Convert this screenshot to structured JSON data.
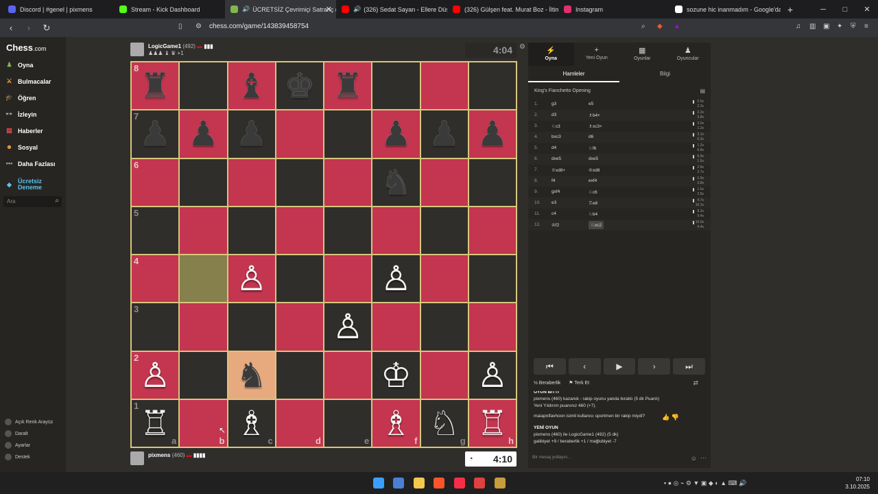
{
  "browser": {
    "tabs": [
      {
        "label": "Discord | #genel | pixmens",
        "color": "#5865f2",
        "sound": false
      },
      {
        "label": "Stream - Kick Dashboard",
        "color": "#53fc18",
        "sound": false
      },
      {
        "label": "ÜCRETSİZ Çevrimiçi Satranç (",
        "color": "#81b64c",
        "sound": true
      },
      {
        "label": "(326) Sedat Sayan - Ellere Düş - Y",
        "color": "#ff0000",
        "sound": true
      },
      {
        "label": "(326) Gülşen feat. Murat Boz - İltima",
        "color": "#ff0000",
        "sound": false
      },
      {
        "label": "Instagram",
        "color": "#e1306c",
        "sound": false
      },
      {
        "label": "sozune hic inanmadım - Google'da A",
        "color": "#ffffff",
        "sound": false
      }
    ],
    "url": "chess.com/game/143839458754",
    "new_tab": "+",
    "min": "─",
    "max": "□",
    "close": "✕"
  },
  "sidebar": {
    "logo": "Chess",
    "logo_suffix": ".com",
    "items": [
      {
        "label": "Oyna",
        "color": "#81b64c"
      },
      {
        "label": "Bulmacalar",
        "color": "#f7a13a"
      },
      {
        "label": "Öğren",
        "color": "#e84a4a"
      },
      {
        "label": "İzleyin",
        "color": "#ffffff"
      },
      {
        "label": "Haberler",
        "color": "#e84a4a"
      },
      {
        "label": "Sosyal",
        "color": "#f7a13a"
      },
      {
        "label": "Daha Fazlası",
        "color": "#aaaaaa"
      }
    ],
    "trial": "Ücretsiz Deneme",
    "search_placeholder": "Ara",
    "bottom": [
      "Açık Renk Arayüz",
      "Daralt",
      "Ayarlar",
      "Destek"
    ]
  },
  "top_player": {
    "name": "LogicGame1",
    "rating": "(492)",
    "captured": "♟♟♟ ♝ ♛ +1",
    "clock": "4:04"
  },
  "bottom_player": {
    "name": "pixmens",
    "rating": "(460)",
    "captured": "",
    "clock": "4:10"
  },
  "board": {
    "ranks": [
      "8",
      "7",
      "6",
      "5",
      "4",
      "3",
      "2",
      "1"
    ],
    "files": [
      "a",
      "b",
      "c",
      "d",
      "e",
      "f",
      "g",
      "h"
    ],
    "pieces": {
      "a8": "♜b",
      "c8": "♝b",
      "d8": "♚b",
      "e8": "♜b",
      "a7": "♟b",
      "b7": "♟b",
      "c7": "♟b",
      "f7": "♟b",
      "g7": "♟b",
      "h7": "♟b",
      "f6": "♞b",
      "c4": "♙w",
      "f4": "♙w",
      "e3": "♙w",
      "a2": "♙w",
      "c2": "♞b",
      "f2": "♔w",
      "h2": "♙w",
      "a1": "♖w",
      "c1": "♗w",
      "f1": "♗w",
      "g1": "♘w",
      "h1": "♖w"
    },
    "highlight_from": "b4",
    "highlight_to": "c2"
  },
  "panel": {
    "tabs": [
      {
        "label": "Oyna",
        "icon": "⚡"
      },
      {
        "label": "Yeni Oyun",
        "icon": "+"
      },
      {
        "label": "Oyunlar",
        "icon": "▦"
      },
      {
        "label": "Oyuncular",
        "icon": "♟"
      }
    ],
    "subtabs": [
      "Hamleler",
      "Bilgi"
    ],
    "opening": "King's Fianchetto Opening",
    "moves": [
      {
        "n": "1.",
        "w": "g3",
        "b": "e5",
        "t1": "0.5s",
        "t2": "2.2s"
      },
      {
        "n": "2.",
        "w": "d3",
        "b": "♗b4+",
        "t1": "2.2s",
        "t2": "3.8s"
      },
      {
        "n": "3.",
        "w": "♘c3",
        "b": "♗xc3+",
        "t1": "3.0s",
        "t2": "1.2s"
      },
      {
        "n": "4.",
        "w": "bxc3",
        "b": "d6",
        "t1": "3.1s",
        "t2": "6.3s"
      },
      {
        "n": "5.",
        "w": "d4",
        "b": "♘f6",
        "t1": "1.2s",
        "t2": "6.8s"
      },
      {
        "n": "6.",
        "w": "dxe5",
        "b": "dxe5",
        "t1": "6.9s",
        "t2": "1.5s"
      },
      {
        "n": "7.",
        "w": "♕xd8+",
        "b": "♔xd8",
        "t1": "2.8s",
        "t2": "2.7s"
      },
      {
        "n": "8.",
        "w": "f4",
        "b": "exf4",
        "t1": "1.9s",
        "t2": "3.8s"
      },
      {
        "n": "9.",
        "w": "gxf4",
        "b": "♘c6",
        "t1": "1.5s",
        "t2": "2.8s"
      },
      {
        "n": "10.",
        "w": "e3",
        "b": "♖e8",
        "t1": "4.7s",
        "t2": "10.1s"
      },
      {
        "n": "11.",
        "w": "c4",
        "b": "♘b4",
        "t1": "8.3s",
        "t2": "9.4s"
      },
      {
        "n": "12.",
        "w": "♔f2",
        "b": "♘xc2",
        "t1": "10.0s",
        "t2": "4.4s"
      }
    ],
    "controls": [
      "⏮",
      "‹",
      "▶",
      "›",
      "⏭"
    ],
    "draw": "½ Beraberlik",
    "resign": "⚑ Terk Et",
    "chat": [
      {
        "text": "OYUN BİTTİ",
        "bold": true
      },
      {
        "text": "pixmens (460) kazandı - rakip oyunu yanda bıraktı (5 dk Puanlı)",
        "bold": false
      },
      {
        "text": "Yeni Yıldırım puanınız 460 (+7).",
        "bold": false
      },
      {
        "text": "maiapnifavhoon isimli kullanıcı sportmen bir rakip miydi?",
        "bold": false
      },
      {
        "text": "YENİ OYUN",
        "bold": true
      },
      {
        "text": "pixmens (460) ile LogicGame1 (492) (5 dk)",
        "bold": false
      },
      {
        "text": "galibiyet +9 / beraberlik +1 / mağlubiyet -7",
        "bold": false
      }
    ],
    "chat_placeholder": "Bir mesaj yollayın..."
  },
  "taskbar": {
    "time": "07:10",
    "date": "3.10.2025"
  }
}
